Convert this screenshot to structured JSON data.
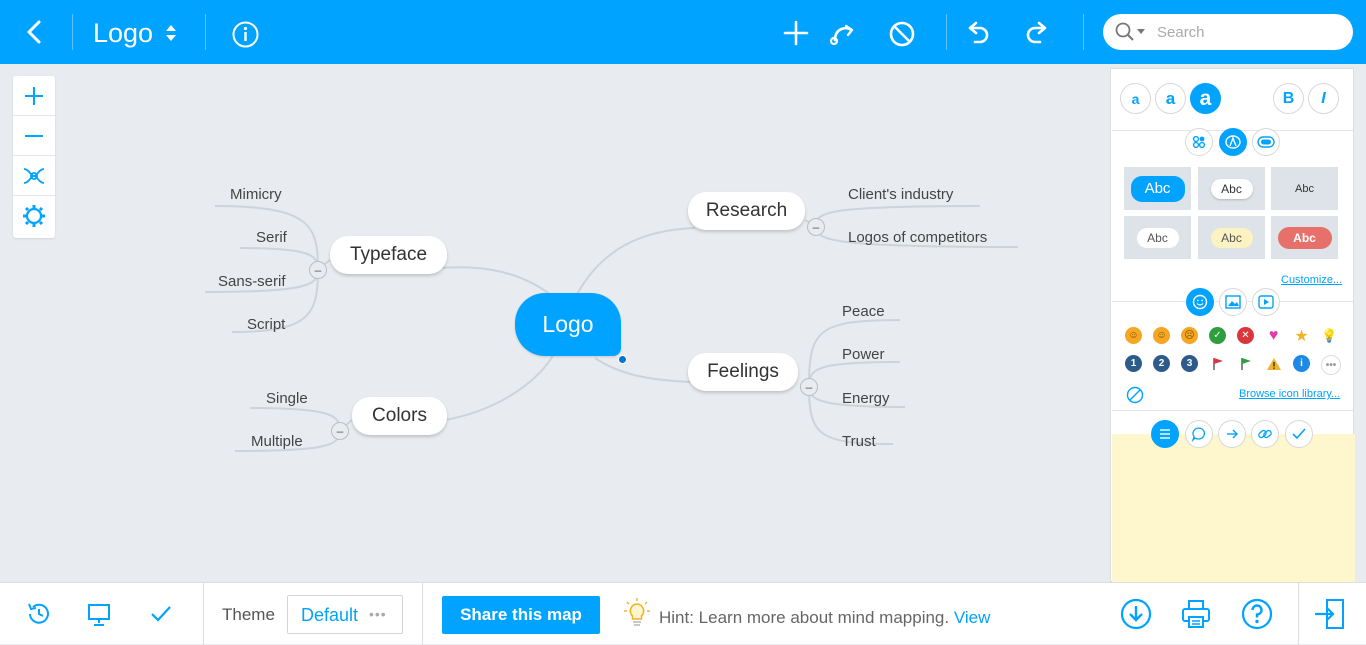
{
  "app": {
    "title": "Logo"
  },
  "search": {
    "placeholder": "Search"
  },
  "map": {
    "central": "Logo",
    "branches": [
      {
        "label": "Typeface",
        "children": [
          "Mimicry",
          "Serif",
          "Sans-serif",
          "Script"
        ]
      },
      {
        "label": "Colors",
        "children": [
          "Single",
          "Multiple"
        ]
      },
      {
        "label": "Research",
        "children": [
          "Client's industry",
          "Logos of competitors"
        ]
      },
      {
        "label": "Feelings",
        "children": [
          "Peace",
          "Power",
          "Energy",
          "Trust"
        ]
      }
    ]
  },
  "panel": {
    "font_sizes": [
      "a",
      "a",
      "a"
    ],
    "bold": "B",
    "italic": "I",
    "style_samples": [
      "Abc",
      "Abc",
      "Abc",
      "Abc",
      "Abc",
      "Abc"
    ],
    "customize_link": "Customize...",
    "browse_link": "Browse icon library...",
    "icon_numbers": [
      "1",
      "2",
      "3"
    ]
  },
  "bottom": {
    "theme_label": "Theme",
    "theme_value": "Default",
    "theme_more": "•••",
    "share_button": "Share this map",
    "hint_text": "Hint: Learn more about mind mapping.",
    "hint_link": "View"
  },
  "colors": {
    "accent": "#00a3ff",
    "canvas": "#e8ecf0",
    "notes": "#fef6cc"
  }
}
